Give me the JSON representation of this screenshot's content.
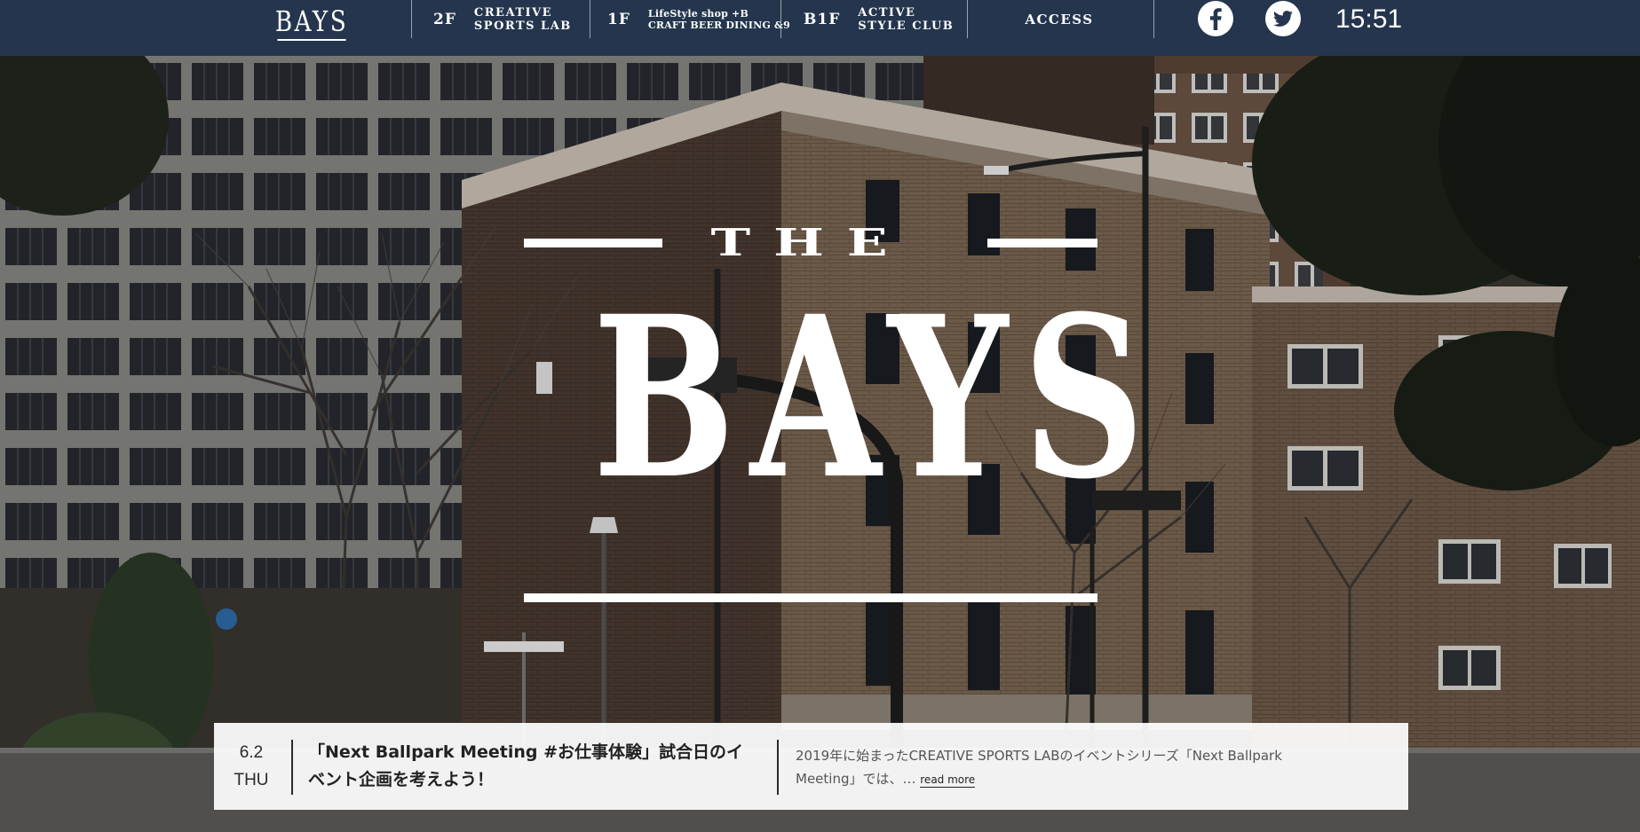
{
  "header": {
    "logo": "BAYS",
    "nav": [
      {
        "floor": "2F",
        "name": "CREATIVE\nSPORTS LAB"
      },
      {
        "floor": "1F",
        "name": "LifeStyle shop +B\nCRAFT BEER DINING &9"
      },
      {
        "floor": "B1F",
        "name": "ACTIVE\nSTYLE CLUB"
      }
    ],
    "access": "ACCESS",
    "social": [
      "facebook-icon",
      "twitter-icon"
    ],
    "clock": "15:51"
  },
  "hero": {
    "the": "THE",
    "title": "BAYS"
  },
  "news": {
    "date": "6.2",
    "weekday": "THU",
    "title": "「Next Ballpark Meeting #お仕事体験」試合日のイベント企画を考えよう！",
    "excerpt": "2019年に始まったCREATIVE SPORTS LABのイベントシリーズ「Next Ballpark Meeting」では、…",
    "read_more": "read more"
  },
  "colors": {
    "header_bg": "#24354d",
    "text_light": "#ffffff",
    "news_bg": "#f2f2f2"
  }
}
